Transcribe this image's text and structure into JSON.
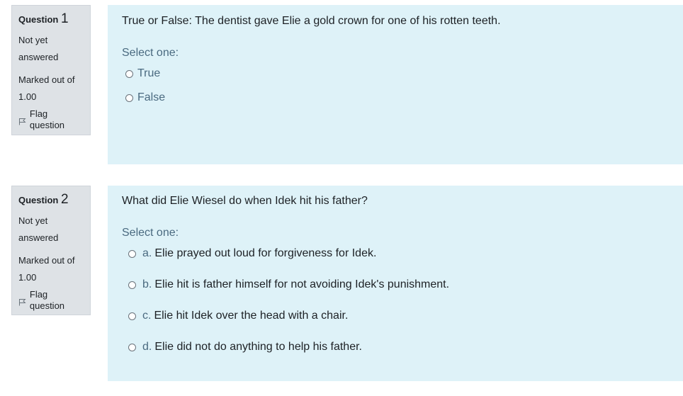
{
  "questions": [
    {
      "label": "Question",
      "number": "1",
      "state_line1": "Not yet",
      "state_line2": "answered",
      "grade_line1": "Marked out of",
      "grade_line2": "1.00",
      "flag_label": "Flag question",
      "text": "True or False: The dentist gave Elie a gold crown for one of his rotten teeth.",
      "prompt": "Select one:",
      "options": [
        {
          "letter": "",
          "text": "True"
        },
        {
          "letter": "",
          "text": "False"
        }
      ]
    },
    {
      "label": "Question",
      "number": "2",
      "state_line1": "Not yet",
      "state_line2": "answered",
      "grade_line1": "Marked out of",
      "grade_line2": "1.00",
      "flag_label": "Flag question",
      "text": "What did Elie Wiesel do when Idek hit his father?",
      "prompt": "Select one:",
      "options": [
        {
          "letter": "a.",
          "text": "Elie prayed out loud for forgiveness for Idek."
        },
        {
          "letter": "b.",
          "text": "Elie hit is father himself for not avoiding Idek's punishment."
        },
        {
          "letter": "c.",
          "text": "Elie hit Idek over the head with a chair."
        },
        {
          "letter": "d.",
          "text": "Elie did not do anything to help his father."
        }
      ]
    }
  ]
}
